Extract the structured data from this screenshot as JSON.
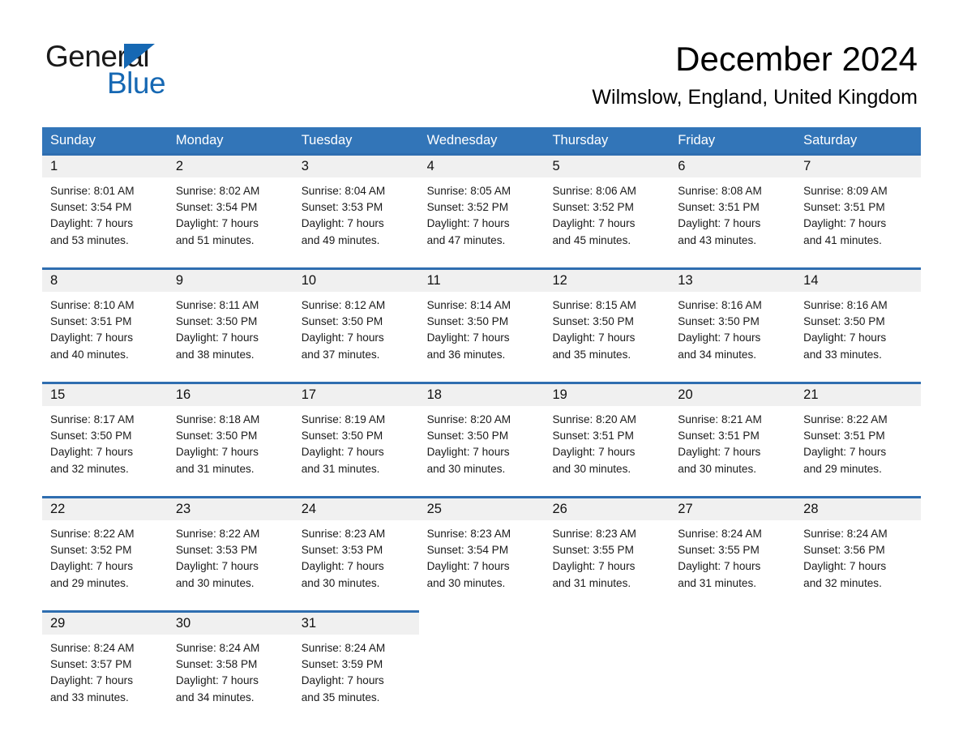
{
  "logo": {
    "word1": "General",
    "word2": "Blue",
    "accent_color": "#1668b3"
  },
  "header": {
    "title": "December 2024",
    "subtitle": "Wilmslow, England, United Kingdom"
  },
  "theme": {
    "header_blue": "#3275b8",
    "separator_blue": "#2f6eb0",
    "daynum_band": "#f0f0f0"
  },
  "weekdays": [
    "Sunday",
    "Monday",
    "Tuesday",
    "Wednesday",
    "Thursday",
    "Friday",
    "Saturday"
  ],
  "labels": {
    "sunrise_prefix": "Sunrise:",
    "sunset_prefix": "Sunset:",
    "daylight_prefix": "Daylight:"
  },
  "weeks": [
    [
      {
        "day": "1",
        "sunrise": "Sunrise: 8:01 AM",
        "sunset": "Sunset: 3:54 PM",
        "daylight1": "Daylight: 7 hours",
        "daylight2": "and 53 minutes."
      },
      {
        "day": "2",
        "sunrise": "Sunrise: 8:02 AM",
        "sunset": "Sunset: 3:54 PM",
        "daylight1": "Daylight: 7 hours",
        "daylight2": "and 51 minutes."
      },
      {
        "day": "3",
        "sunrise": "Sunrise: 8:04 AM",
        "sunset": "Sunset: 3:53 PM",
        "daylight1": "Daylight: 7 hours",
        "daylight2": "and 49 minutes."
      },
      {
        "day": "4",
        "sunrise": "Sunrise: 8:05 AM",
        "sunset": "Sunset: 3:52 PM",
        "daylight1": "Daylight: 7 hours",
        "daylight2": "and 47 minutes."
      },
      {
        "day": "5",
        "sunrise": "Sunrise: 8:06 AM",
        "sunset": "Sunset: 3:52 PM",
        "daylight1": "Daylight: 7 hours",
        "daylight2": "and 45 minutes."
      },
      {
        "day": "6",
        "sunrise": "Sunrise: 8:08 AM",
        "sunset": "Sunset: 3:51 PM",
        "daylight1": "Daylight: 7 hours",
        "daylight2": "and 43 minutes."
      },
      {
        "day": "7",
        "sunrise": "Sunrise: 8:09 AM",
        "sunset": "Sunset: 3:51 PM",
        "daylight1": "Daylight: 7 hours",
        "daylight2": "and 41 minutes."
      }
    ],
    [
      {
        "day": "8",
        "sunrise": "Sunrise: 8:10 AM",
        "sunset": "Sunset: 3:51 PM",
        "daylight1": "Daylight: 7 hours",
        "daylight2": "and 40 minutes."
      },
      {
        "day": "9",
        "sunrise": "Sunrise: 8:11 AM",
        "sunset": "Sunset: 3:50 PM",
        "daylight1": "Daylight: 7 hours",
        "daylight2": "and 38 minutes."
      },
      {
        "day": "10",
        "sunrise": "Sunrise: 8:12 AM",
        "sunset": "Sunset: 3:50 PM",
        "daylight1": "Daylight: 7 hours",
        "daylight2": "and 37 minutes."
      },
      {
        "day": "11",
        "sunrise": "Sunrise: 8:14 AM",
        "sunset": "Sunset: 3:50 PM",
        "daylight1": "Daylight: 7 hours",
        "daylight2": "and 36 minutes."
      },
      {
        "day": "12",
        "sunrise": "Sunrise: 8:15 AM",
        "sunset": "Sunset: 3:50 PM",
        "daylight1": "Daylight: 7 hours",
        "daylight2": "and 35 minutes."
      },
      {
        "day": "13",
        "sunrise": "Sunrise: 8:16 AM",
        "sunset": "Sunset: 3:50 PM",
        "daylight1": "Daylight: 7 hours",
        "daylight2": "and 34 minutes."
      },
      {
        "day": "14",
        "sunrise": "Sunrise: 8:16 AM",
        "sunset": "Sunset: 3:50 PM",
        "daylight1": "Daylight: 7 hours",
        "daylight2": "and 33 minutes."
      }
    ],
    [
      {
        "day": "15",
        "sunrise": "Sunrise: 8:17 AM",
        "sunset": "Sunset: 3:50 PM",
        "daylight1": "Daylight: 7 hours",
        "daylight2": "and 32 minutes."
      },
      {
        "day": "16",
        "sunrise": "Sunrise: 8:18 AM",
        "sunset": "Sunset: 3:50 PM",
        "daylight1": "Daylight: 7 hours",
        "daylight2": "and 31 minutes."
      },
      {
        "day": "17",
        "sunrise": "Sunrise: 8:19 AM",
        "sunset": "Sunset: 3:50 PM",
        "daylight1": "Daylight: 7 hours",
        "daylight2": "and 31 minutes."
      },
      {
        "day": "18",
        "sunrise": "Sunrise: 8:20 AM",
        "sunset": "Sunset: 3:50 PM",
        "daylight1": "Daylight: 7 hours",
        "daylight2": "and 30 minutes."
      },
      {
        "day": "19",
        "sunrise": "Sunrise: 8:20 AM",
        "sunset": "Sunset: 3:51 PM",
        "daylight1": "Daylight: 7 hours",
        "daylight2": "and 30 minutes."
      },
      {
        "day": "20",
        "sunrise": "Sunrise: 8:21 AM",
        "sunset": "Sunset: 3:51 PM",
        "daylight1": "Daylight: 7 hours",
        "daylight2": "and 30 minutes."
      },
      {
        "day": "21",
        "sunrise": "Sunrise: 8:22 AM",
        "sunset": "Sunset: 3:51 PM",
        "daylight1": "Daylight: 7 hours",
        "daylight2": "and 29 minutes."
      }
    ],
    [
      {
        "day": "22",
        "sunrise": "Sunrise: 8:22 AM",
        "sunset": "Sunset: 3:52 PM",
        "daylight1": "Daylight: 7 hours",
        "daylight2": "and 29 minutes."
      },
      {
        "day": "23",
        "sunrise": "Sunrise: 8:22 AM",
        "sunset": "Sunset: 3:53 PM",
        "daylight1": "Daylight: 7 hours",
        "daylight2": "and 30 minutes."
      },
      {
        "day": "24",
        "sunrise": "Sunrise: 8:23 AM",
        "sunset": "Sunset: 3:53 PM",
        "daylight1": "Daylight: 7 hours",
        "daylight2": "and 30 minutes."
      },
      {
        "day": "25",
        "sunrise": "Sunrise: 8:23 AM",
        "sunset": "Sunset: 3:54 PM",
        "daylight1": "Daylight: 7 hours",
        "daylight2": "and 30 minutes."
      },
      {
        "day": "26",
        "sunrise": "Sunrise: 8:23 AM",
        "sunset": "Sunset: 3:55 PM",
        "daylight1": "Daylight: 7 hours",
        "daylight2": "and 31 minutes."
      },
      {
        "day": "27",
        "sunrise": "Sunrise: 8:24 AM",
        "sunset": "Sunset: 3:55 PM",
        "daylight1": "Daylight: 7 hours",
        "daylight2": "and 31 minutes."
      },
      {
        "day": "28",
        "sunrise": "Sunrise: 8:24 AM",
        "sunset": "Sunset: 3:56 PM",
        "daylight1": "Daylight: 7 hours",
        "daylight2": "and 32 minutes."
      }
    ],
    [
      {
        "day": "29",
        "sunrise": "Sunrise: 8:24 AM",
        "sunset": "Sunset: 3:57 PM",
        "daylight1": "Daylight: 7 hours",
        "daylight2": "and 33 minutes."
      },
      {
        "day": "30",
        "sunrise": "Sunrise: 8:24 AM",
        "sunset": "Sunset: 3:58 PM",
        "daylight1": "Daylight: 7 hours",
        "daylight2": "and 34 minutes."
      },
      {
        "day": "31",
        "sunrise": "Sunrise: 8:24 AM",
        "sunset": "Sunset: 3:59 PM",
        "daylight1": "Daylight: 7 hours",
        "daylight2": "and 35 minutes."
      },
      {
        "day": "",
        "sunrise": "",
        "sunset": "",
        "daylight1": "",
        "daylight2": ""
      },
      {
        "day": "",
        "sunrise": "",
        "sunset": "",
        "daylight1": "",
        "daylight2": ""
      },
      {
        "day": "",
        "sunrise": "",
        "sunset": "",
        "daylight1": "",
        "daylight2": ""
      },
      {
        "day": "",
        "sunrise": "",
        "sunset": "",
        "daylight1": "",
        "daylight2": ""
      }
    ]
  ]
}
